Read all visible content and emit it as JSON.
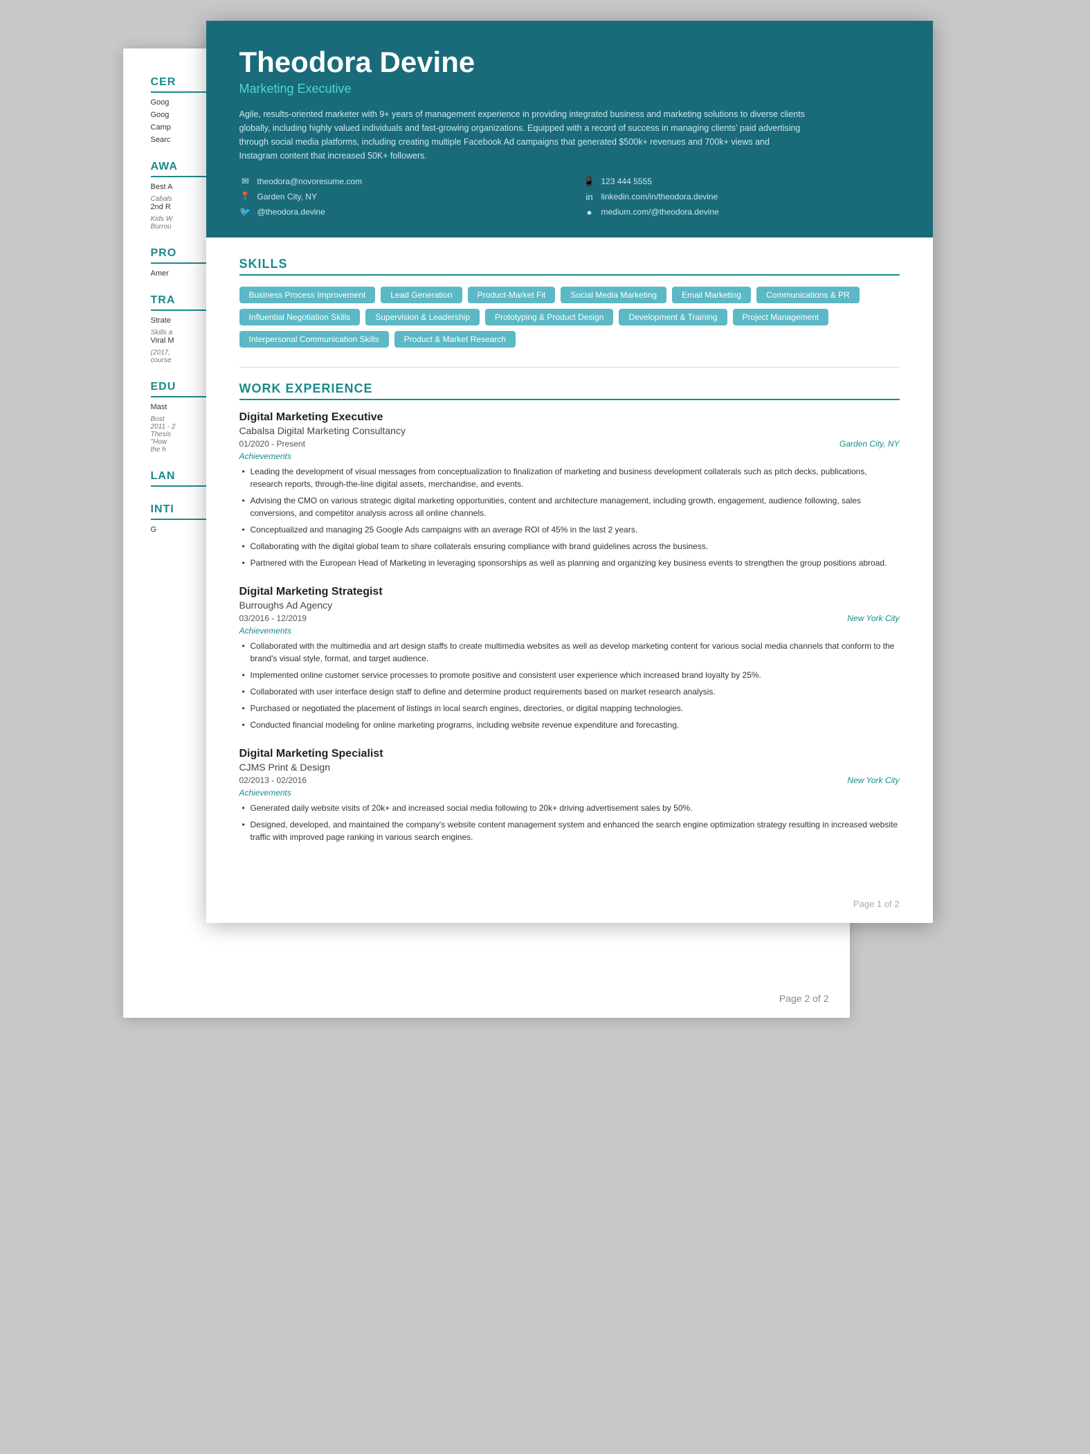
{
  "background_page": {
    "label": "Page 2 of 2",
    "sidebar": {
      "sections": [
        {
          "title": "CER",
          "items": [
            {
              "text": "Goog",
              "sub": ""
            },
            {
              "text": "Goog",
              "sub": ""
            },
            {
              "text": "Camp",
              "sub": ""
            },
            {
              "text": "Searc",
              "sub": ""
            }
          ]
        },
        {
          "title": "AWA",
          "items": [
            {
              "text": "Best A",
              "sub": "Cabals"
            },
            {
              "text": "2nd R",
              "sub": "Kids W"
            },
            {
              "text": "",
              "sub": "Burrou"
            }
          ]
        },
        {
          "title": "PRO",
          "items": [
            {
              "text": "Amer",
              "sub": ""
            }
          ]
        },
        {
          "title": "TRA",
          "items": [
            {
              "text": "Strate",
              "sub": "Skills a"
            },
            {
              "text": "Viral M",
              "sub": "(2017,"
            },
            {
              "text": "",
              "sub": "course"
            }
          ]
        },
        {
          "title": "EDU",
          "items": [
            {
              "text": "Mast",
              "sub": "Bost"
            },
            {
              "text": "2011 - 2",
              "sub": "Thesis"
            },
            {
              "text": "\"How",
              "sub": "the h"
            }
          ]
        },
        {
          "title": "LAN",
          "items": []
        },
        {
          "title": "INTI",
          "items": [
            {
              "text": "G",
              "sub": ""
            }
          ]
        }
      ]
    }
  },
  "header": {
    "name": "Theodora Devine",
    "title": "Marketing Executive",
    "summary": "Agile, results-oriented marketer with 9+ years of management experience in providing integrated business and marketing solutions to diverse clients globally, including highly valued individuals and fast-growing organizations. Equipped with a record of success in managing clients' paid advertising through social media platforms, including creating multiple Facebook Ad campaigns that generated $500k+ revenues and 700k+ views and Instagram content that increased 50K+ followers.",
    "contact": {
      "email": "theodora@novoresume.com",
      "phone": "123 444 5555",
      "address": "Garden City, NY",
      "linkedin": "linkedin.com/in/theodora.devine",
      "twitter": "@theodora.devine",
      "medium": "medium.com/@theodora.devine"
    }
  },
  "skills": {
    "title": "SKILLS",
    "tags": [
      "Business Process Improvement",
      "Lead Generation",
      "Product-Market Fit",
      "Social Media Marketing",
      "Email Marketing",
      "Communications & PR",
      "Influential Negotiation Skills",
      "Supervision & Leadership",
      "Prototyping & Product Design",
      "Development & Training",
      "Project Management",
      "Interpersonal Communication Skills",
      "Product & Market Research"
    ]
  },
  "work_experience": {
    "title": "WORK EXPERIENCE",
    "jobs": [
      {
        "title": "Digital Marketing Executive",
        "company": "Cabalsa Digital Marketing Consultancy",
        "dates": "01/2020 - Present",
        "location": "Garden City, NY",
        "achievements_label": "Achievements",
        "bullets": [
          "Leading the development of visual messages from conceptualization to finalization of marketing and business development collaterals such as pitch decks, publications, research reports, through-the-line digital assets, merchandise, and events.",
          "Advising the CMO on various strategic digital marketing opportunities, content and architecture management, including growth, engagement, audience following, sales conversions, and competitor analysis across all online channels.",
          "Conceptualized and managing 25 Google Ads campaigns with an average ROI of 45% in the last 2 years.",
          "Collaborating with the digital global team to share collaterals ensuring compliance with brand guidelines across the business.",
          "Partnered with the European Head of Marketing in leveraging sponsorships as well as planning and organizing key business events to strengthen the group positions abroad."
        ]
      },
      {
        "title": "Digital Marketing Strategist",
        "company": "Burroughs Ad Agency",
        "dates": "03/2016 - 12/2019",
        "location": "New York City",
        "achievements_label": "Achievements",
        "bullets": [
          "Collaborated with the multimedia and art design staffs to create multimedia websites as well as develop marketing content for various social media channels that conform to the brand's visual style, format, and target audience.",
          "Implemented online customer service processes to promote positive and consistent user experience which increased brand loyalty by 25%.",
          "Collaborated with user interface design staff to define and determine product requirements based on market research analysis.",
          "Purchased or negotiated the placement of listings in local search engines, directories, or digital mapping technologies.",
          "Conducted financial modeling for online marketing programs, including website revenue expenditure and forecasting."
        ]
      },
      {
        "title": "Digital Marketing Specialist",
        "company": "CJMS Print & Design",
        "dates": "02/2013 - 02/2016",
        "location": "New York City",
        "achievements_label": "Achievements",
        "bullets": [
          "Generated daily website visits of 20k+ and increased social media following to 20k+ driving advertisement sales by 50%.",
          "Designed, developed, and maintained the company's website content management system and enhanced the search engine optimization strategy resulting in increased website traffic with improved page ranking in various search engines."
        ]
      }
    ]
  },
  "page_label": "Page 1 of 2"
}
